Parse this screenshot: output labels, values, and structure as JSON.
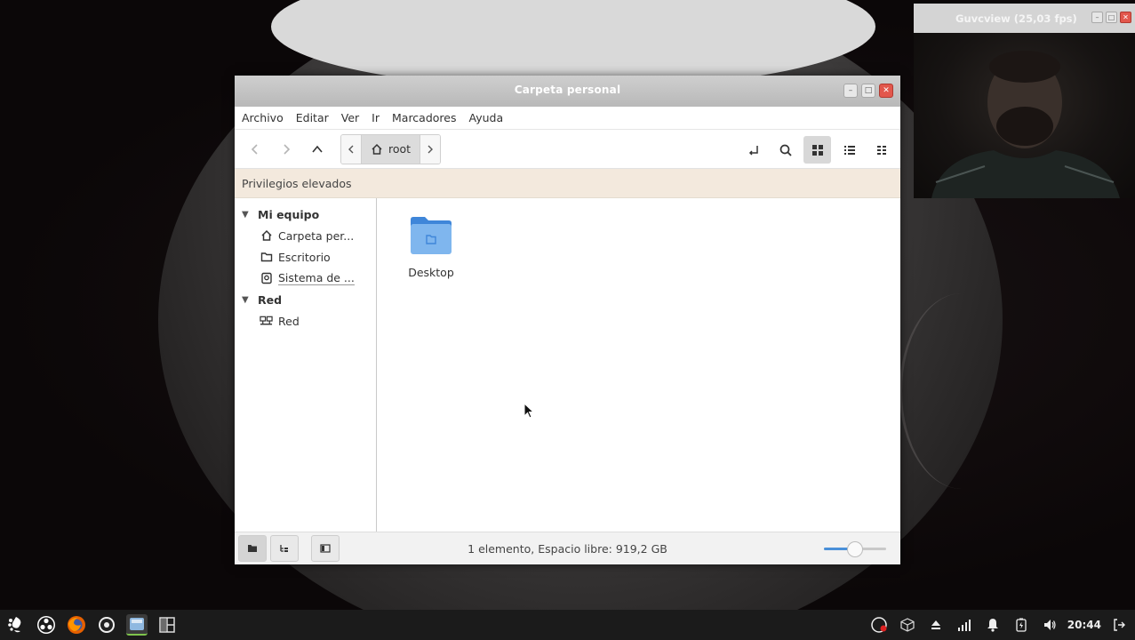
{
  "window": {
    "title": "Carpeta personal"
  },
  "menu": {
    "items": [
      "Archivo",
      "Editar",
      "Ver",
      "Ir",
      "Marcadores",
      "Ayuda"
    ]
  },
  "path": {
    "crumb": "root"
  },
  "infobar": {
    "text": "Privilegios elevados"
  },
  "sidebar": {
    "section1": {
      "title": "Mi equipo",
      "items": [
        "Carpeta per...",
        "Escritorio",
        "Sistema de ..."
      ]
    },
    "section2": {
      "title": "Red",
      "items": [
        "Red"
      ]
    }
  },
  "files": [
    {
      "name": "Desktop",
      "icon": "folder-icon"
    }
  ],
  "status": {
    "text": "1  elemento, Espacio libre: 919,2 GB",
    "zoom_fraction": 0.5
  },
  "webcam": {
    "title": "Guvcview  (25,03 fps)"
  },
  "taskbar": {
    "clock": "20:44"
  },
  "colors": {
    "infobar_bg": "#f3e9dd",
    "folder": "#5b9ee8",
    "taskbar_active": "#7ec44c"
  }
}
